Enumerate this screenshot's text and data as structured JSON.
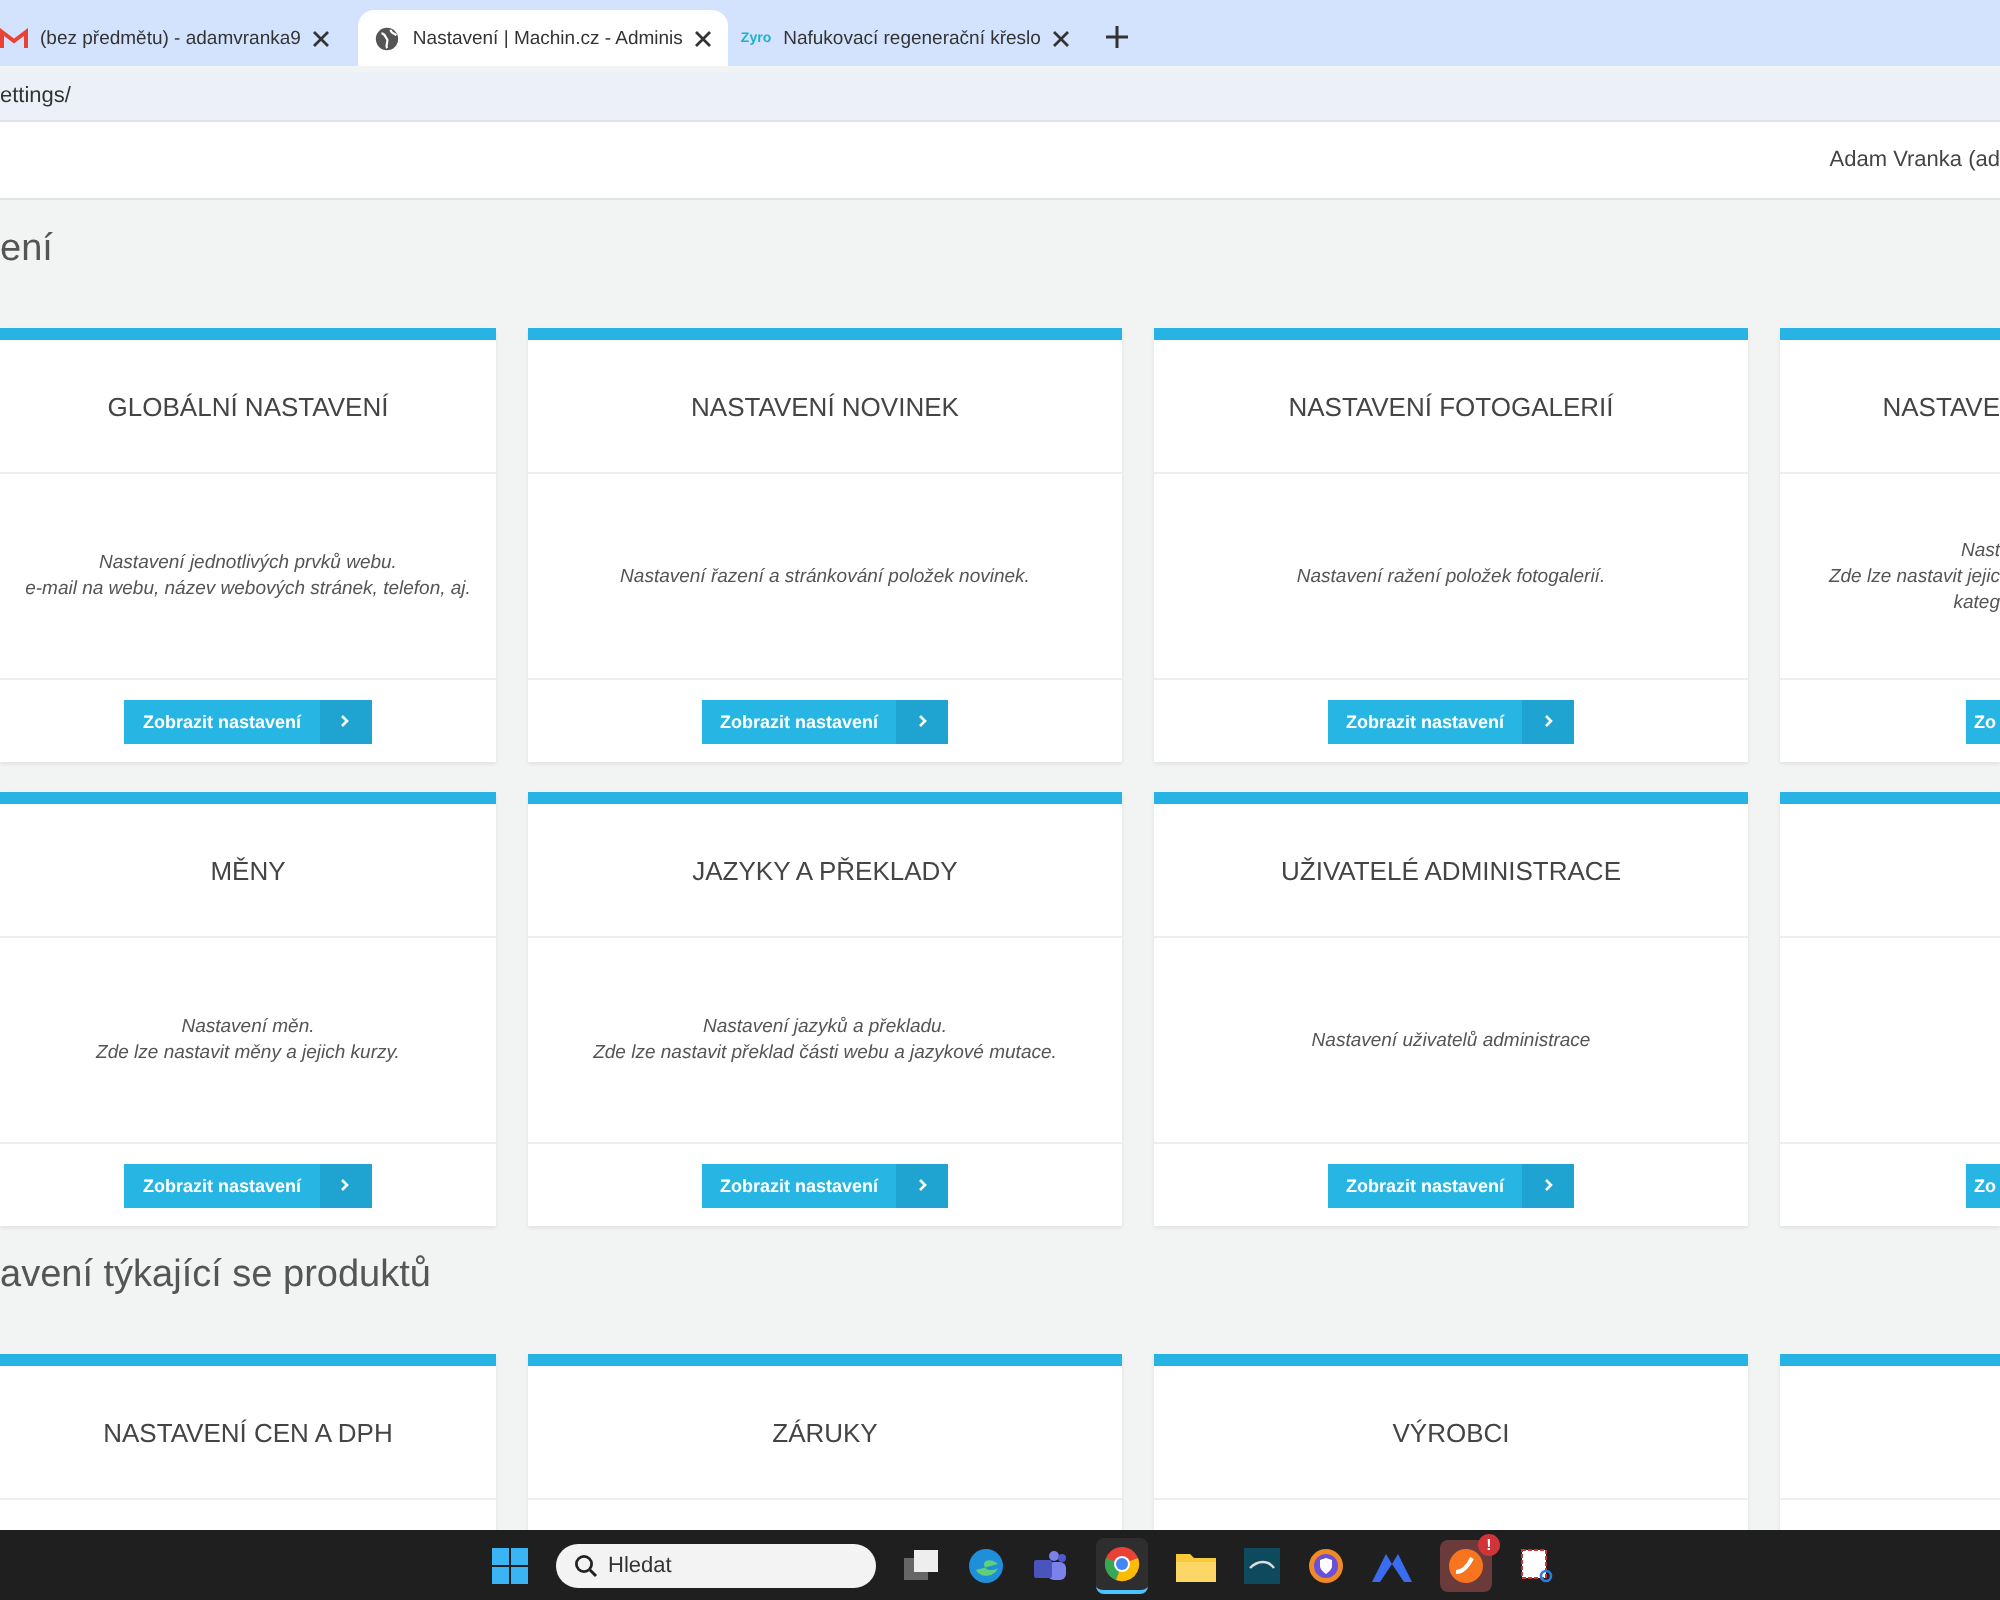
{
  "browser": {
    "tabs": [
      {
        "kind": "mail",
        "title": "(bez předmětu) - adamvranka9",
        "selected": false
      },
      {
        "kind": "globe",
        "title": "Nastavení | Machin.cz - Adminis",
        "selected": true
      },
      {
        "kind": "text",
        "favicon_text": "Zyro",
        "title": "Nafukovací regenerační křeslo",
        "selected": false
      }
    ],
    "address": "ettings/"
  },
  "header": {
    "user": "Adam Vranka (ad"
  },
  "sections": [
    {
      "title": "ení",
      "cards": [
        {
          "kind": "full",
          "title": "GLOBÁLNÍ NASTAVENÍ",
          "lines": [
            "Nastavení jednotlivých prvků webu.",
            "e-mail na webu, název webových stránek, telefon, aj."
          ],
          "button": "Zobrazit nastavení"
        },
        {
          "kind": "full",
          "title": "NASTAVENÍ NOVINEK",
          "lines": [
            "Nastavení řazení a stránkování položek novinek."
          ],
          "button": "Zobrazit nastavení"
        },
        {
          "kind": "full",
          "title": "NASTAVENÍ FOTOGALERIÍ",
          "lines": [
            "Nastavení ražení položek fotogalerií."
          ],
          "button": "Zobrazit nastavení"
        },
        {
          "kind": "partial",
          "title": "NASTAVE",
          "lines": [
            "Nast",
            "Zde lze nastavit jejic",
            "kateg"
          ],
          "button": "Zo"
        },
        {
          "kind": "full",
          "title": "MĚNY",
          "lines": [
            "Nastavení měn.",
            "Zde lze nastavit měny a jejich kurzy."
          ],
          "button": "Zobrazit nastavení"
        },
        {
          "kind": "full",
          "title": "JAZYKY A PŘEKLADY",
          "lines": [
            "Nastavení jazyků a překladu.",
            "Zde lze nastavit překlad části webu a jazykové mutace."
          ],
          "button": "Zobrazit nastavení"
        },
        {
          "kind": "full",
          "title": "UŽIVATELÉ ADMINISTRACE",
          "lines": [
            "Nastavení uživatelů administrace"
          ],
          "button": "Zobrazit nastavení"
        },
        {
          "kind": "partial",
          "button": "Zo"
        }
      ]
    },
    {
      "title": "avení týkající se produktů",
      "cards": [
        {
          "kind": "full",
          "title": "NASTAVENÍ CEN A DPH"
        },
        {
          "kind": "full",
          "title": "ZÁRUKY"
        },
        {
          "kind": "full",
          "title": "VÝROBCI"
        },
        {
          "kind": "partial"
        }
      ]
    }
  ],
  "taskbar": {
    "search_placeholder": "Hledat",
    "badge": "!"
  }
}
